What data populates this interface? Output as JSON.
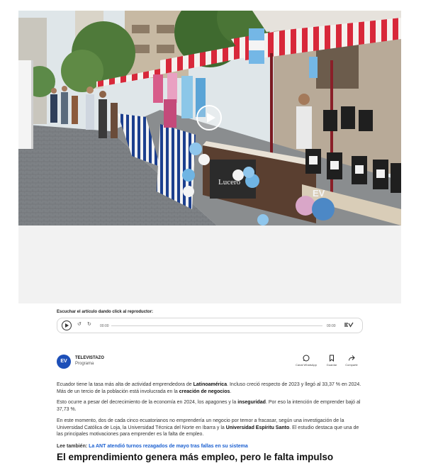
{
  "player": {
    "listen_label": "Escuchar el artículo dando click al reproductor:",
    "back_label": "10",
    "forward_label": "10",
    "current_time": "00:00",
    "duration": "00:00"
  },
  "author": {
    "logo_text": "EV",
    "name": "TELEVISTAZO",
    "role": "Programa"
  },
  "share_actions": [
    {
      "label": "Canal WhatsApp",
      "icon": "whatsapp-icon"
    },
    {
      "label": "Guardar",
      "icon": "bookmark-icon"
    },
    {
      "label": "Compartir",
      "icon": "share-icon"
    }
  ],
  "article": {
    "p1": {
      "t1": "Ecuador tiene la tasa más alta de actividad emprendedora de ",
      "b1": "Latinoamérica",
      "t2": ". Incluso creció respecto de 2023 y llegó al 33,37 % en 2024. Más de un tercio de la población está involucrada en la ",
      "b2": "creación de negocios",
      "t3": "."
    },
    "p2": {
      "t1": "Esto ocurre a pesar del decrecimiento de la economía en 2024, los apagones y la ",
      "b1": "inseguridad",
      "t2": ". Por eso la intención de emprender bajó al 37,73 %."
    },
    "p3": {
      "t1": "En este momento, dos de cada cinco ecuatorianos no emprendería un negocio por temor a fracasar, según una investigación de la Universidad Católica de Loja, la Universidad Técnica del Norte en Ibarra y la ",
      "b1": "Universidad Espíritu Santo",
      "t2": ". El estudio destaca que una de las principales motivaciones para emprender es la falta de empleo."
    },
    "see_also_label": "Lee también:",
    "see_also_link": "La ANT atendió turnos rezagados de mayo tras fallas en su sistema",
    "subheading": "El emprendimiento genera más empleo, pero le falta impulso"
  },
  "colors": {
    "brand_blue": "#1d4fb8",
    "link_blue": "#1a5fd0",
    "flag_light_blue": "#74b7e6"
  }
}
